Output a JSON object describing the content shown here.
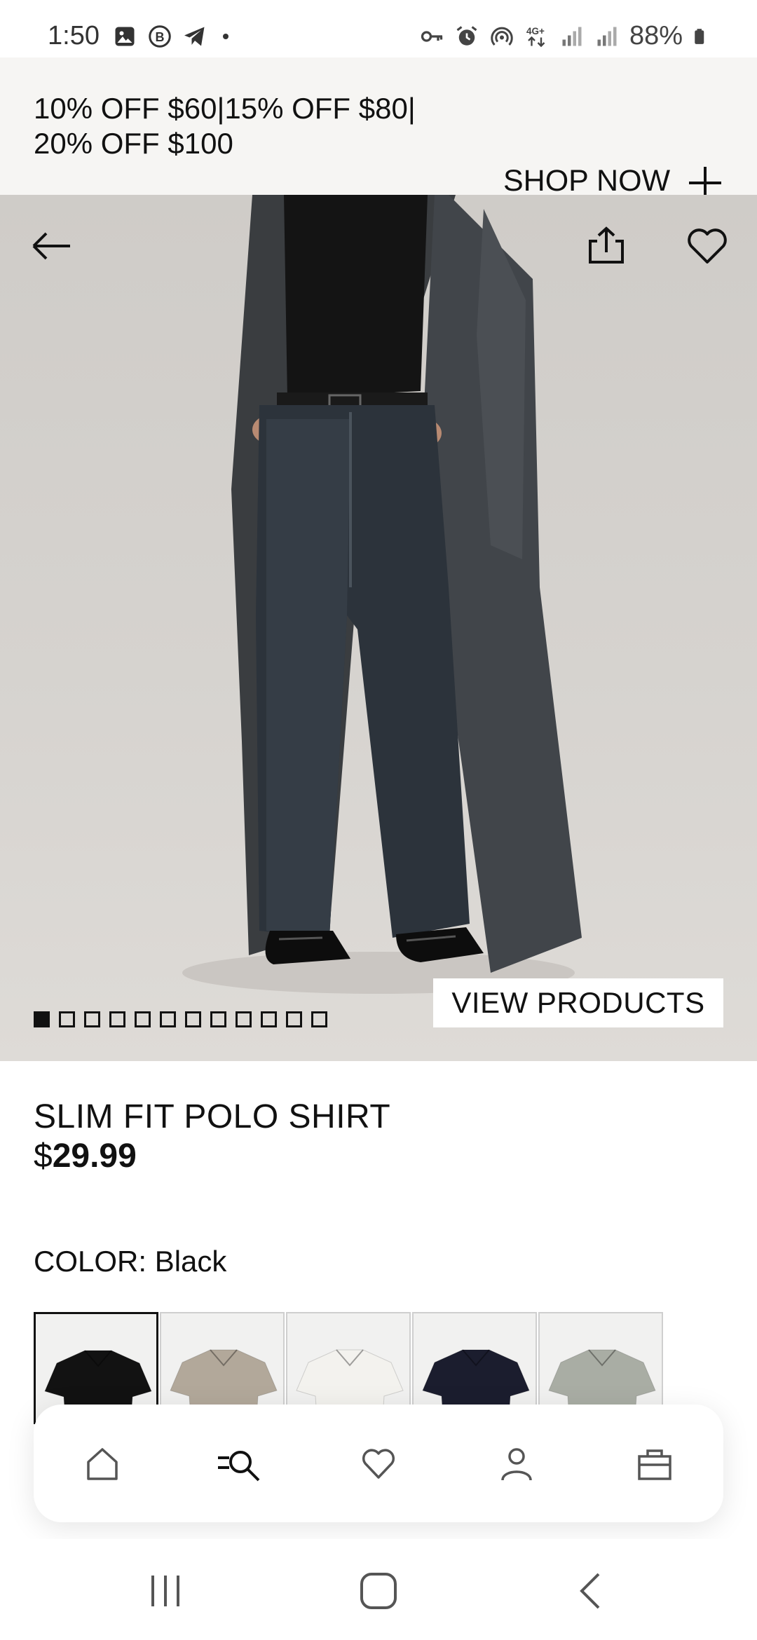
{
  "status_bar": {
    "time": "1:50",
    "battery_text": "88%",
    "left_icons": [
      "gallery-icon",
      "b-badge-icon",
      "telegram-icon",
      "dot-icon"
    ],
    "right_icons": [
      "key-icon",
      "alarm-icon",
      "hotspot-icon",
      "4g-lte-icon",
      "signal-icon",
      "signal-icon",
      "battery-icon"
    ]
  },
  "promo": {
    "text_line1": "10% OFF $60|15% OFF $80|",
    "text_line2": "20% OFF $100",
    "cta_label": "SHOP NOW",
    "expand_icon": "plus-icon"
  },
  "hero": {
    "back_icon": "arrow-left-icon",
    "share_icon": "share-icon",
    "favorite_icon": "heart-icon",
    "view_products_label": "VIEW PRODUCTS",
    "slides_total": 12,
    "slide_active": 1
  },
  "product": {
    "title": "SLIM FIT POLO SHIRT",
    "currency": "$",
    "price": "29.99",
    "color_label": "COLOR:",
    "color_value": "Black",
    "swatches": [
      {
        "name": "Black",
        "hex": "#121212",
        "selected": true
      },
      {
        "name": "Beige",
        "hex": "#b2a89a",
        "selected": false
      },
      {
        "name": "White",
        "hex": "#f3f2ee",
        "selected": false
      },
      {
        "name": "Navy",
        "hex": "#1b1d2e",
        "selected": false
      },
      {
        "name": "Sage",
        "hex": "#a9ada4",
        "selected": false
      }
    ]
  },
  "bottom_nav": {
    "items": [
      {
        "icon": "home-icon"
      },
      {
        "icon": "search-menu-icon"
      },
      {
        "icon": "heart-icon"
      },
      {
        "icon": "account-icon"
      },
      {
        "icon": "shopping-bag-icon"
      }
    ]
  },
  "system_nav": {
    "items": [
      "recents-icon",
      "home-button-icon",
      "back-icon"
    ]
  }
}
